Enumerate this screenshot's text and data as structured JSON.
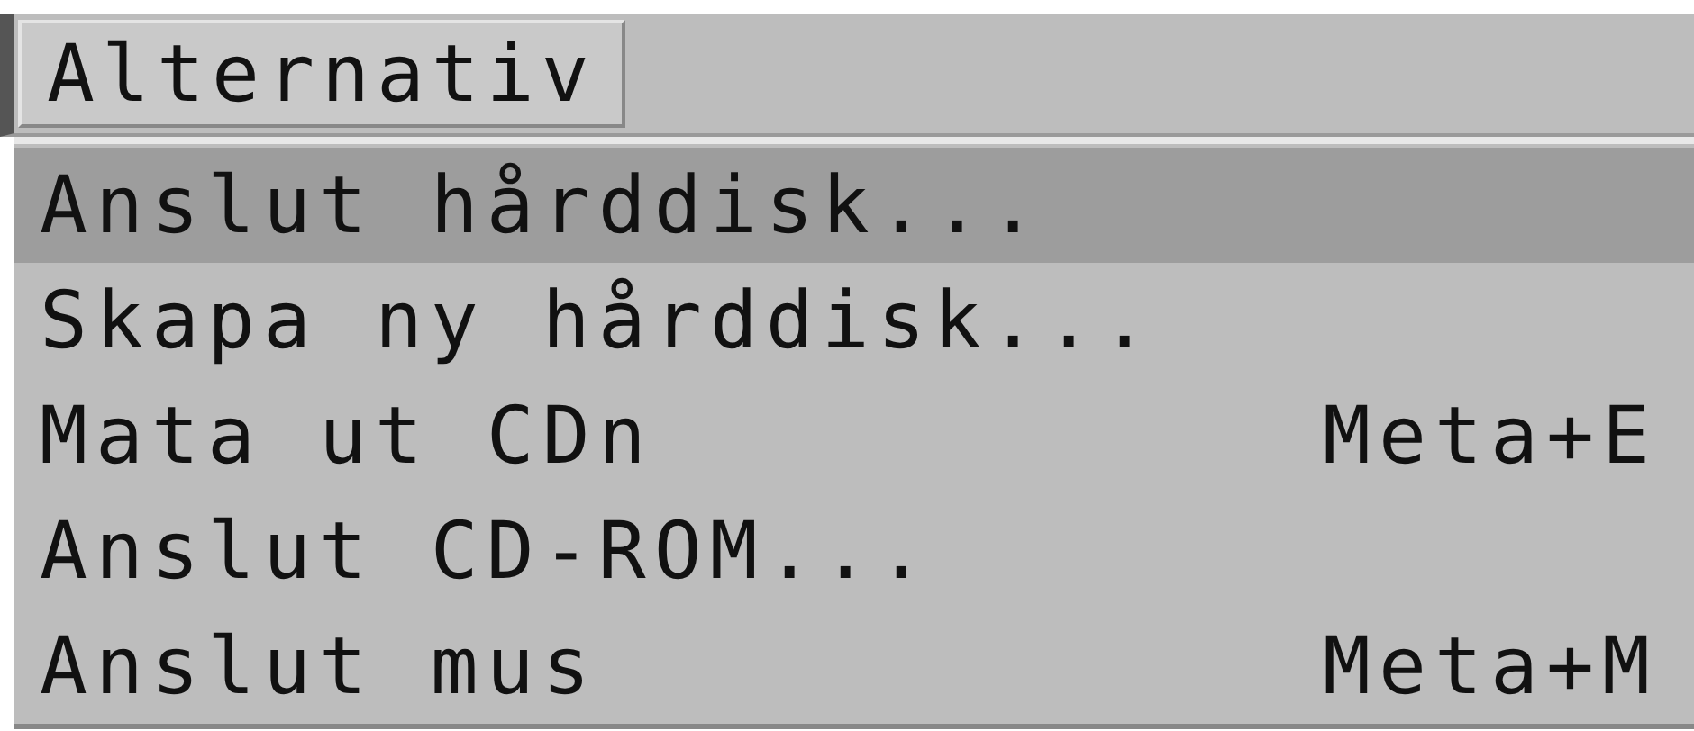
{
  "menu_bar": [
    {
      "label": "Alternativ",
      "selected": true
    }
  ],
  "menu": {
    "items": [
      {
        "label": "Anslut hårddisk...",
        "selected": true
      },
      {
        "label": "Skapa ny hårddisk...",
        "selected": false
      },
      {
        "label": "Mata ut CDn",
        "shortcut": "Meta+E",
        "selected": false
      },
      {
        "label": "Anslut CD-ROM...",
        "selected": false
      },
      {
        "label": "Anslut mus",
        "shortcut": "Meta+M",
        "selected": false
      }
    ]
  }
}
